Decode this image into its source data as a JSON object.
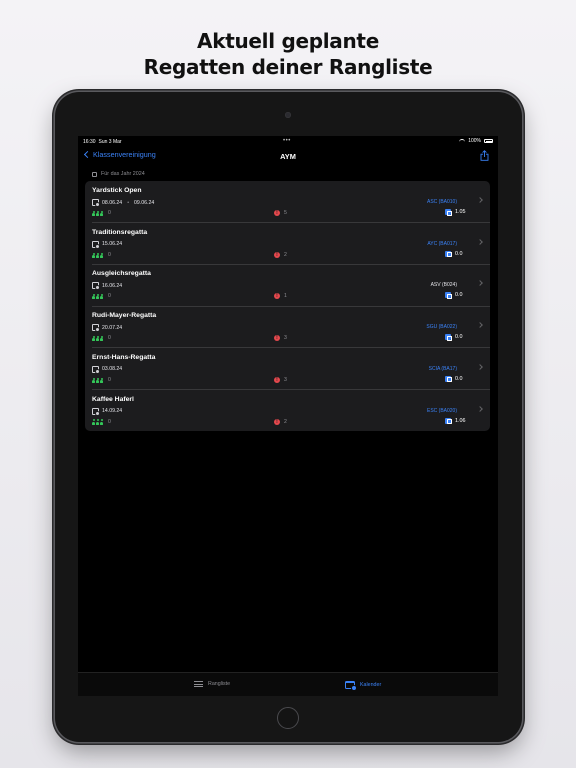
{
  "headline": {
    "line1": "Aktuell geplante",
    "line2": "Regatten deiner Rangliste"
  },
  "statusbar": {
    "time": "16:30",
    "date": "Sun 3 Mar",
    "dots": "•••",
    "battery": "100%"
  },
  "navbar": {
    "back_label": "Klassenvereinigung",
    "title": "AYM"
  },
  "section": {
    "label": "Für das Jahr 2024"
  },
  "regattas": [
    {
      "name": "Yardstick Open",
      "start": "08.06.24",
      "end": "09.06.24",
      "participants": "0",
      "alerts": "5",
      "club": "ASC (BA010)",
      "club_highlight": true,
      "score": "1.05"
    },
    {
      "name": "Traditionsregatta",
      "start": "15.06.24",
      "participants": "0",
      "alerts": "2",
      "club": "AYC (BA017)",
      "club_highlight": true,
      "score": "0.0"
    },
    {
      "name": "Ausgleichsregatta",
      "start": "16.06.24",
      "participants": "0",
      "alerts": "1",
      "club": "ASV (B024)",
      "club_highlight": false,
      "score": "0.0"
    },
    {
      "name": "Rudi-Mayer-Regatta",
      "start": "20.07.24",
      "participants": "0",
      "alerts": "3",
      "club": "SGU (BA022)",
      "club_highlight": true,
      "score": "0.0"
    },
    {
      "name": "Ernst-Hans-Regatta",
      "start": "03.08.24",
      "participants": "0",
      "alerts": "3",
      "club": "SCIA (BA17)",
      "club_highlight": true,
      "score": "0.0"
    },
    {
      "name": "Kaffee Haferl",
      "start": "14.09.24",
      "participants": "0",
      "alerts": "2",
      "club": "ESC (BA020)",
      "club_highlight": true,
      "score": "1.06"
    }
  ],
  "tabbar": {
    "tab_rangliste": "Rangliste",
    "tab_kalender": "Kalender",
    "active": "Kalender"
  },
  "colors": {
    "accent": "#3b82f6",
    "people": "#34c759",
    "alert": "#e5484d",
    "card": "#1c1c1e"
  },
  "icons": {
    "back": "chevron-left-icon",
    "share": "share-icon",
    "dates": "calendar-icon",
    "participants": "people-icon",
    "alerts": "alert-icon",
    "score": "score-icon",
    "rangliste": "list-icon",
    "kalender": "calendar-tab-icon"
  }
}
